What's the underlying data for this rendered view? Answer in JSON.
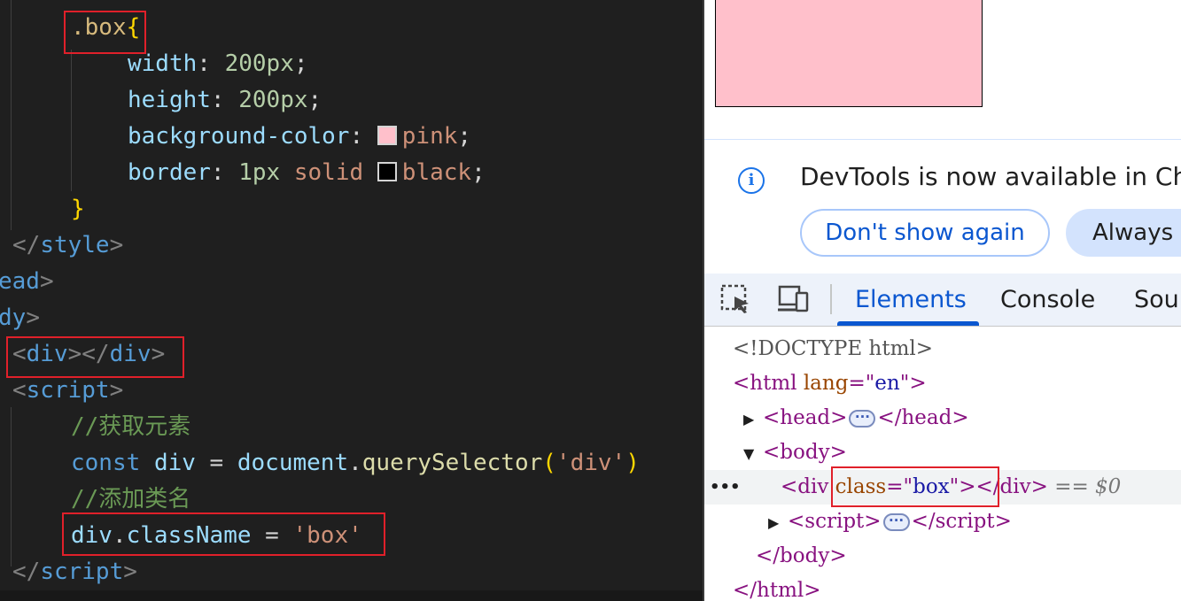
{
  "editor": {
    "selector": ".box",
    "open_brace": "{",
    "close_brace": "}",
    "props": [
      {
        "name": "width",
        "value": "200px"
      },
      {
        "name": "height",
        "value": "200px"
      },
      {
        "name": "background-color",
        "value": "pink",
        "swatch": "#ffc0cb"
      },
      {
        "name": "border",
        "value_num": "1px",
        "value_kw": "solid",
        "value": "black",
        "swatch": "#000000"
      }
    ],
    "style_close_tag": "style",
    "head_close_fragment": "ead",
    "body_fragment": "dy",
    "div_tag": "div",
    "script_tag": "script",
    "comment1": "//获取元素",
    "const_kw": "const",
    "const_var": "div",
    "doc_obj": "document",
    "method": "querySelector",
    "method_arg": "'div'",
    "comment2": "//添加类名",
    "assign_obj": "div",
    "assign_prop": "className",
    "assign_value": "'box'",
    "script_close_tag": "script"
  },
  "devtools": {
    "notice_text": "DevTools is now available in Chinese!",
    "dont_show_label": "Don't show again",
    "always_label": "Always match Chrome's language",
    "tabs": [
      "Elements",
      "Console",
      "Sources"
    ],
    "dom": {
      "doctype": "<!DOCTYPE html>",
      "html_tag": "html",
      "html_attr": "lang",
      "html_val": "en",
      "head_tag": "head",
      "body_tag": "body",
      "div_tag": "div",
      "div_attr": "class",
      "div_val": "box",
      "eq_ref": "== $0",
      "script_tag": "script"
    }
  },
  "colors": {
    "editor_bg": "#1f1f1f",
    "highlight": "#e0202a",
    "box_color": "#ffc0cb",
    "accent": "#0b57d0"
  }
}
